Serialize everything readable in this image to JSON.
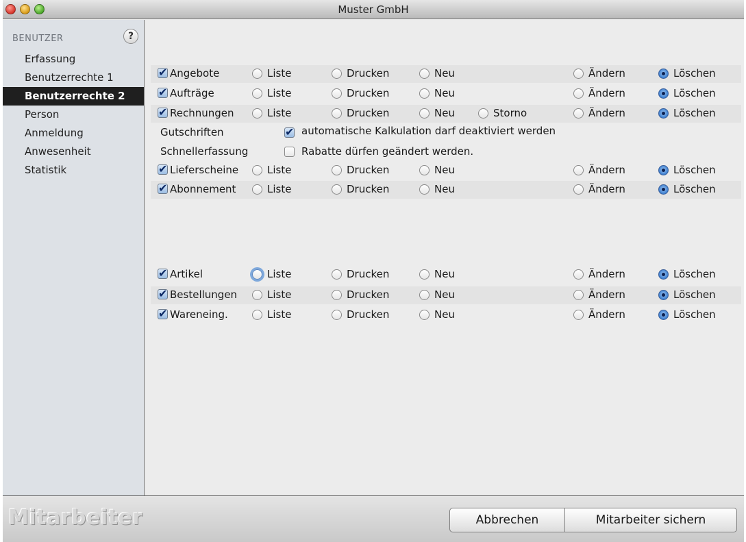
{
  "window": {
    "title": "Muster GmbH"
  },
  "sidebar": {
    "header": "BENUTZER",
    "help_label": "?",
    "items": [
      {
        "label": "Erfassung",
        "active": false
      },
      {
        "label": "Benutzerrechte 1",
        "active": false
      },
      {
        "label": "Benutzerrechte 2",
        "active": true
      },
      {
        "label": "Person",
        "active": false
      },
      {
        "label": "Anmeldung",
        "active": false
      },
      {
        "label": "Anwesenheit",
        "active": false
      },
      {
        "label": "Statistik",
        "active": false
      }
    ]
  },
  "permissions": {
    "option_labels": {
      "liste": "Liste",
      "drucken": "Drucken",
      "neu": "Neu",
      "storno": "Storno",
      "aendern": "Ändern",
      "loeschen": "Löschen"
    },
    "rows": [
      {
        "label": "Angebote",
        "checked": true,
        "selected": "loeschen",
        "has_storno": false
      },
      {
        "label": "Aufträge",
        "checked": true,
        "selected": "loeschen",
        "has_storno": false
      },
      {
        "label": "Rechnungen",
        "checked": true,
        "selected": "loeschen",
        "has_storno": true
      },
      {
        "label": "Lieferscheine",
        "checked": true,
        "selected": "loeschen",
        "has_storno": false
      },
      {
        "label": "Abonnement",
        "checked": true,
        "selected": "loeschen",
        "has_storno": false
      },
      {
        "label": "Artikel",
        "checked": true,
        "selected": "loeschen",
        "has_storno": false,
        "focused": "liste"
      },
      {
        "label": "Bestellungen",
        "checked": true,
        "selected": "loeschen",
        "has_storno": false
      },
      {
        "label": "Wareneing.",
        "checked": true,
        "selected": "loeschen",
        "has_storno": false
      }
    ],
    "gutschriften_label": "Gutschriften",
    "schnellerfassung_label": "Schnellerfassung",
    "auto_kalkulation": {
      "label": "automatische Kalkulation darf deaktiviert werden",
      "checked": true
    },
    "rabatte": {
      "label": "Rabatte dürfen geändert werden.",
      "checked": false
    }
  },
  "footer": {
    "brand": "Mitarbeiter",
    "cancel_label": "Abbrechen",
    "save_label": "Mitarbeiter sichern"
  }
}
